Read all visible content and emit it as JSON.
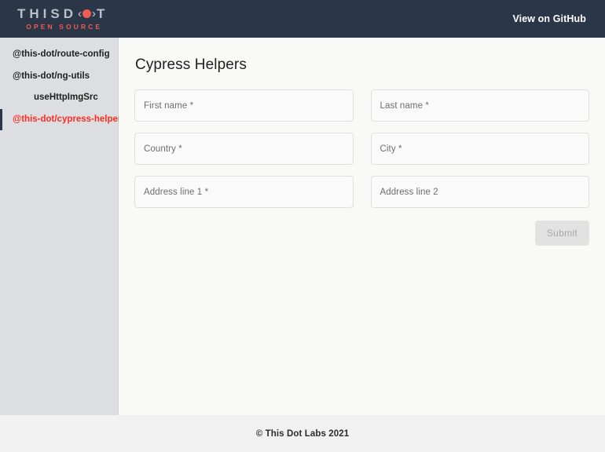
{
  "header": {
    "logo": {
      "text_part1": "THIS",
      "text_part2": "D",
      "text_part3": "T",
      "bracket_left": "‹",
      "bracket_right": "›",
      "subtitle": "OPEN SOURCE",
      "accent_color": "#ef5b50",
      "background_color": "#2b3648"
    },
    "github_label": "View on GitHub"
  },
  "sidebar": {
    "items": [
      {
        "label": "@this-dot/route-config",
        "active": false,
        "sub": false
      },
      {
        "label": "@this-dot/ng-utils",
        "active": false,
        "sub": false
      },
      {
        "label": "useHttpImgSrc",
        "active": false,
        "sub": true
      },
      {
        "label": "@this-dot/cypress-helpers",
        "active": true,
        "sub": false
      }
    ],
    "active_color": "#ff2d20",
    "background_color": "#dcdee1"
  },
  "main": {
    "title": "Cypress Helpers",
    "fields": [
      {
        "placeholder": "First name *",
        "value": ""
      },
      {
        "placeholder": "Last name *",
        "value": ""
      },
      {
        "placeholder": "Country *",
        "value": ""
      },
      {
        "placeholder": "City *",
        "value": ""
      },
      {
        "placeholder": "Address line 1 *",
        "value": ""
      },
      {
        "placeholder": "Address line 2",
        "value": ""
      }
    ],
    "submit_label": "Submit",
    "submit_disabled": true
  },
  "footer": {
    "copyright": "© This Dot Labs 2021"
  }
}
